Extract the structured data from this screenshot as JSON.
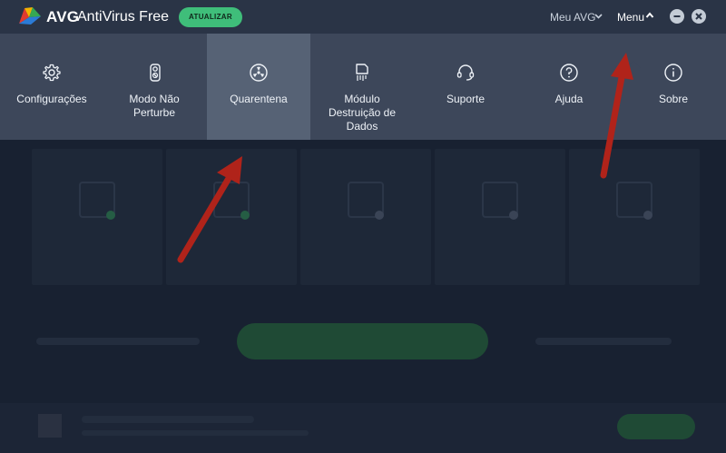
{
  "app": {
    "brand": "AVG",
    "product": "AntiVirus Free",
    "upgrade_label": "ATUALIZAR",
    "my_avg_label": "Meu AVG",
    "menu_label": "Menu"
  },
  "menu": {
    "items": [
      {
        "id": "configuracoes",
        "label": "Configurações",
        "icon": "gear-icon"
      },
      {
        "id": "modo-nao-perturbe",
        "label": "Modo Não Perturbe",
        "icon": "door-hanger-icon"
      },
      {
        "id": "quarentena",
        "label": "Quarentena",
        "icon": "biohazard-icon",
        "active": true
      },
      {
        "id": "modulo-destruicao",
        "label": "Módulo Destruição de Dados",
        "icon": "shredder-icon"
      },
      {
        "id": "suporte",
        "label": "Suporte",
        "icon": "headset-icon"
      },
      {
        "id": "ajuda",
        "label": "Ajuda",
        "icon": "question-icon"
      },
      {
        "id": "sobre",
        "label": "Sobre",
        "icon": "info-icon"
      }
    ]
  },
  "colors": {
    "titlebar": "#2a3446",
    "menu_panel": "#3d475a",
    "menu_active": "#566275",
    "accent_green": "#3fbe7a",
    "annotation_arrow": "#b0231a"
  }
}
